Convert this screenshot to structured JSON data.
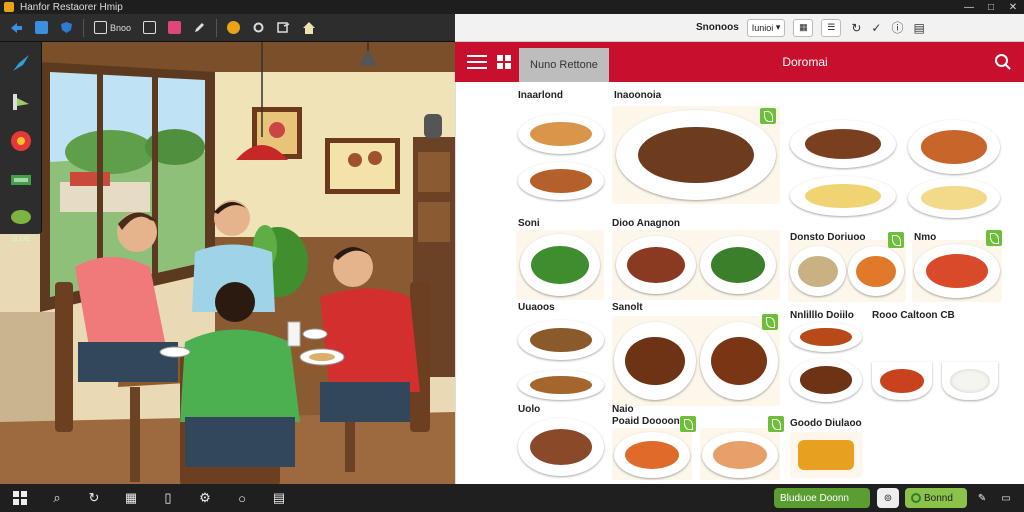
{
  "window": {
    "title": "Hanfor Restaorer Hmip",
    "controls": [
      "—",
      "□",
      "✕"
    ]
  },
  "editor": {
    "toolbar": [
      {
        "icon": "arrow-icon",
        "label": "",
        "color": "#3b8fe0"
      },
      {
        "icon": "image-icon",
        "label": "",
        "color": "#3b8fe0"
      },
      {
        "icon": "shield-icon",
        "label": "",
        "color": "#2f7bd1"
      },
      {
        "icon": "monitor-icon",
        "label": "Bnoo",
        "color": "#dddddd"
      },
      {
        "icon": "grid-icon",
        "label": "",
        "color": "#dddddd"
      },
      {
        "icon": "file-icon",
        "label": "",
        "color": "#e0457b"
      },
      {
        "icon": "pen-icon",
        "label": "",
        "color": "#dddddd"
      },
      {
        "icon": "palette-icon",
        "label": "",
        "color": "#e8a317"
      },
      {
        "icon": "settings-icon",
        "label": "",
        "color": "#dddddd"
      },
      {
        "icon": "layers-icon",
        "label": "",
        "color": "#dddddd"
      },
      {
        "icon": "home-icon",
        "label": "",
        "color": "#f0e0b0"
      }
    ],
    "tools": [
      {
        "icon": "brush-icon",
        "label": "",
        "color": "#2fa0d8"
      },
      {
        "icon": "pen-tool-icon",
        "label": "",
        "color": "#9ccc65"
      },
      {
        "icon": "color-wheel-icon",
        "label": "",
        "color": "#e53935"
      },
      {
        "icon": "swatch-icon",
        "label": "",
        "color": "#43a047"
      },
      {
        "icon": "leaf-tool-icon",
        "label": "SLUE",
        "color": "#7cb342"
      }
    ]
  },
  "browser": {
    "toolbar": {
      "title": "Snonoos",
      "tab_label": "Iunioi",
      "icons": [
        "dropdown-icon",
        "grid-icon",
        "list-icon",
        "refresh-icon",
        "check-icon",
        "info-icon",
        "clipboard-icon"
      ]
    },
    "site": {
      "brand": "Nuno Rettone",
      "page_title": "Doromai",
      "accent": "#c8102e"
    },
    "sections": {
      "s1": "Inaarlond",
      "s2": "Inaoonoia",
      "s3": "Soni",
      "s4": "Dioo Anagnon",
      "s5": "Donsto Doriuoo",
      "s6": "Nmo",
      "s7": "Uuaoos",
      "s8": "Sanolt",
      "s9": "Nnlilllo Doiilo",
      "s10": "Rooo Caltoon CB",
      "s11": "Uolo",
      "s12": "Naio",
      "s13": "Poaid Doooon",
      "s14": "Goodo Diulaoo"
    }
  },
  "taskbar": {
    "icons": [
      "windows-icon",
      "search-icon",
      "refresh-icon",
      "calculator-icon",
      "document-icon",
      "settings-icon",
      "circle-icon",
      "notes-icon"
    ],
    "pill1": "Bluduoe Doonn",
    "pill2": "Bonnd",
    "tray_icons": [
      "tray-edit-icon",
      "tray-chat-icon"
    ]
  }
}
